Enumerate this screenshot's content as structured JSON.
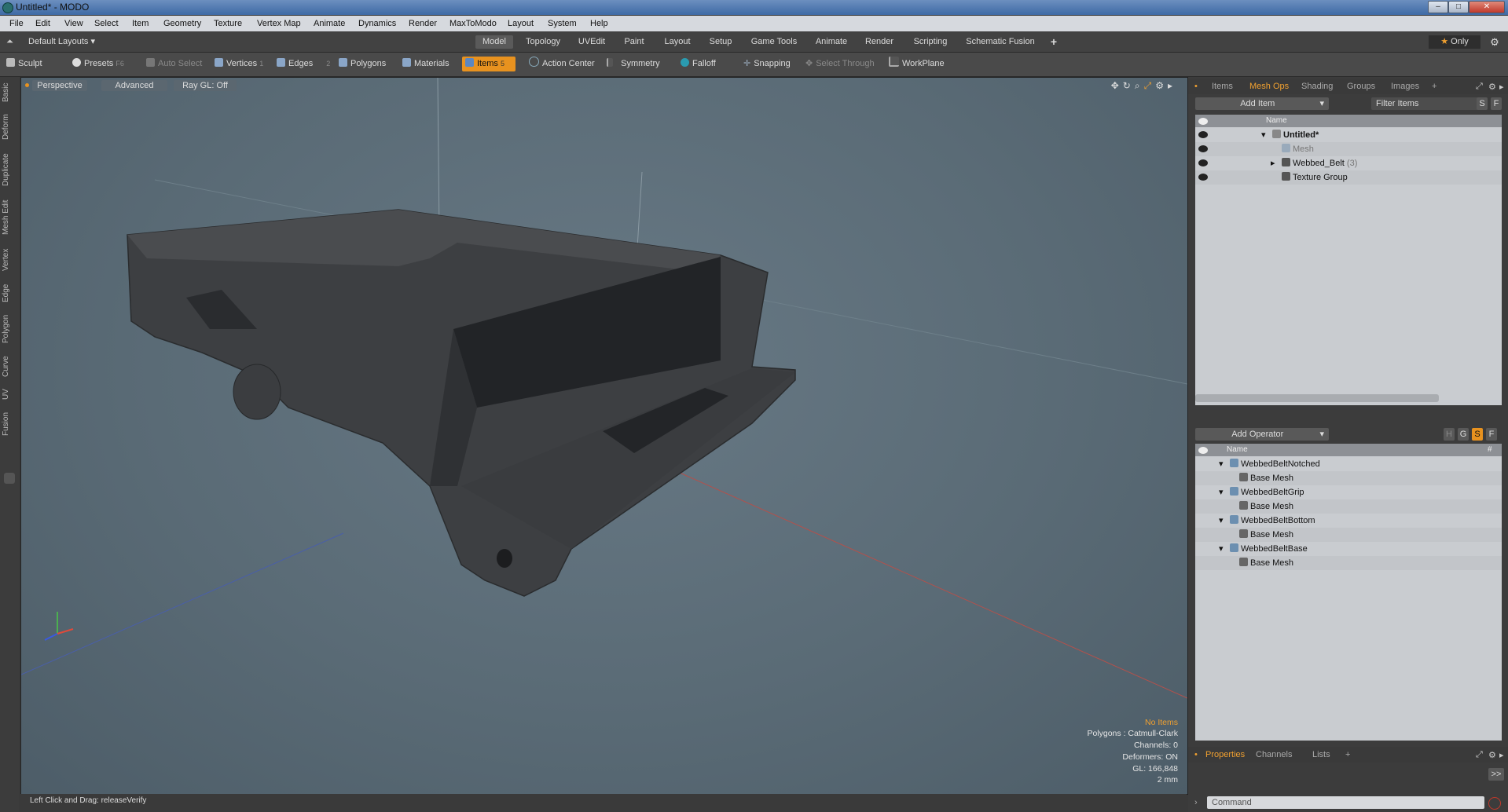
{
  "window": {
    "title": "Untitled* - MODO"
  },
  "menubar": [
    "File",
    "Edit",
    "View",
    "Select",
    "Item",
    "Geometry",
    "Texture",
    "Vertex Map",
    "Animate",
    "Dynamics",
    "Render",
    "MaxToModo",
    "Layout",
    "System",
    "Help"
  ],
  "layoutbar": {
    "layout_select": "Default Layouts",
    "tabs": [
      "Model",
      "Topology",
      "UVEdit",
      "Paint",
      "Layout",
      "Setup",
      "Game Tools",
      "Animate",
      "Render",
      "Scripting",
      "Schematic Fusion"
    ],
    "add": "+",
    "only_label": "Only"
  },
  "toolbar": {
    "sculpt": "Sculpt",
    "presets": "Presets",
    "presets_key": "F6",
    "auto_select": "Auto Select",
    "vertices": "Vertices",
    "vertices_key": "1",
    "edges": "Edges",
    "edges_key": "2",
    "polygons": "Polygons",
    "materials": "Materials",
    "items": "Items",
    "items_key": "5",
    "action_center": "Action Center",
    "symmetry": "Symmetry",
    "falloff": "Falloff",
    "snapping": "Snapping",
    "select_through": "Select Through",
    "workplane": "WorkPlane"
  },
  "left_tabs": [
    "Basic",
    "Deform",
    "Duplicate",
    "Mesh Edit",
    "Vertex",
    "Edge",
    "Polygon",
    "Curve",
    "UV",
    "Fusion"
  ],
  "viewport": {
    "view_mode": "Perspective",
    "shading": "Advanced",
    "raygl": "Ray GL: Off",
    "hud": {
      "status": "No Items",
      "polygons": "Polygons : Catmull-Clark",
      "channels": "Channels: 0",
      "deformers": "Deformers: ON",
      "gl": "GL: 166,848",
      "units": "2 mm"
    }
  },
  "statusbar": {
    "hint": "Left Click and Drag:  releaseVerify"
  },
  "items_panel": {
    "tabs": [
      "Items",
      "Mesh Ops",
      "Shading",
      "Groups",
      "Images"
    ],
    "add_tab": "+",
    "add_item": "Add Item",
    "filter": "Filter Items",
    "s_btn": "S",
    "f_btn": "F",
    "col_name": "Name",
    "tree": [
      {
        "label": "Untitled*",
        "suffix": ""
      },
      {
        "label": "Mesh",
        "suffix": ""
      },
      {
        "label": "Webbed_Belt",
        "suffix": "(3)"
      },
      {
        "label": "Texture Group",
        "suffix": ""
      }
    ]
  },
  "meshops_panel": {
    "add_operator": "Add Operator",
    "flags": [
      "H",
      "G",
      "S",
      "F"
    ],
    "col_name": "Name",
    "col_hash": "#",
    "tree": [
      {
        "label": "WebbedBeltNotched",
        "child": "Base Mesh"
      },
      {
        "label": "WebbedBeltGrip",
        "child": "Base Mesh"
      },
      {
        "label": "WebbedBeltBottom",
        "child": "Base Mesh"
      },
      {
        "label": "WebbedBeltBase",
        "child": "Base Mesh"
      }
    ]
  },
  "properties_panel": {
    "tabs": [
      "Properties",
      "Channels",
      "Lists"
    ],
    "add_tab": "+",
    "expand": ">>",
    "command_placeholder": "Command"
  },
  "colors": {
    "accent": "#e8921f",
    "viewport_bg": "#5e6f7a",
    "panel_bg": "#3c3c3c"
  }
}
